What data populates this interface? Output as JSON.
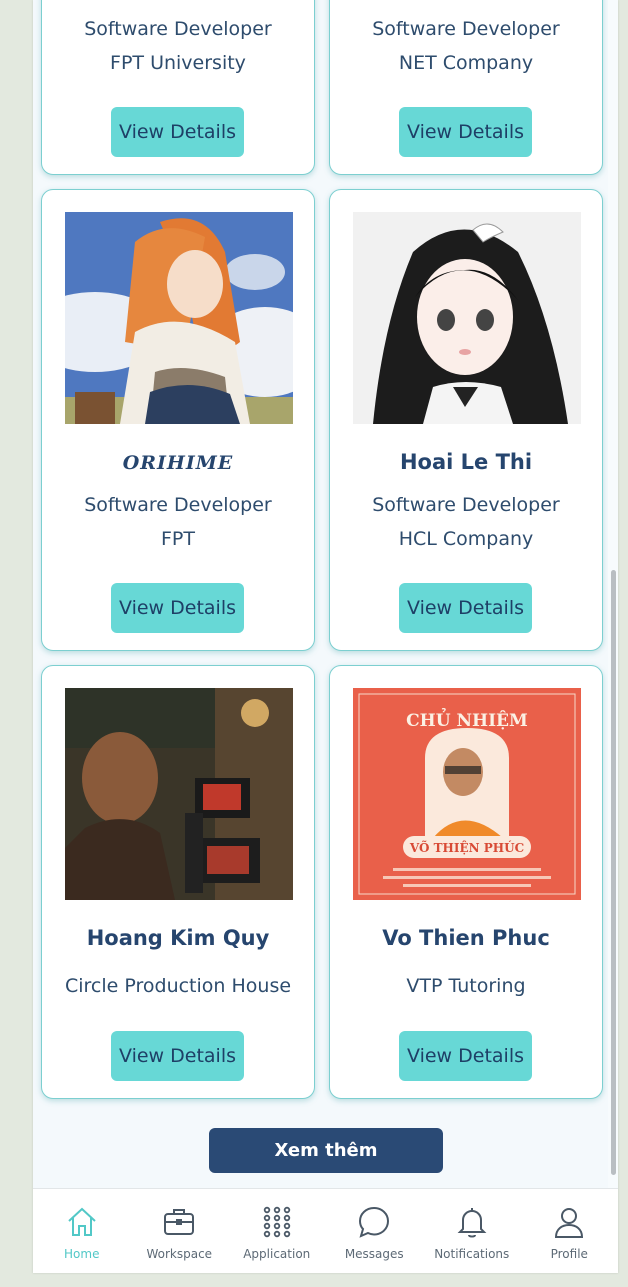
{
  "cards": [
    {
      "name": "",
      "line1": "Software Developer",
      "line2": "FPT University",
      "button": "View Details"
    },
    {
      "name": "",
      "line1": "Software Developer",
      "line2": "NET Company",
      "button": "View Details"
    },
    {
      "name": "ORIHIME",
      "line1": "Software Developer",
      "line2": "FPT",
      "button": "View Details"
    },
    {
      "name": "Hoai Le Thi",
      "line1": "Software Developer",
      "line2": "HCL Company",
      "button": "View Details"
    },
    {
      "name": "Hoang Kim Quy",
      "line1": "Circle Production House",
      "button": "View Details"
    },
    {
      "name": "Vo Thien Phuc",
      "line1": "VTP Tutoring",
      "button": "View Details"
    }
  ],
  "poster": {
    "title": "CHỦ NHIỆM",
    "banner": "VÕ THIỆN PHÚC"
  },
  "more_button": "Xem thêm",
  "nav": {
    "active": "home",
    "items": [
      {
        "id": "home",
        "label": "Home",
        "icon": "home-icon"
      },
      {
        "id": "workspace",
        "label": "Workspace",
        "icon": "briefcase-icon"
      },
      {
        "id": "application",
        "label": "Application",
        "icon": "grid-dots-icon"
      },
      {
        "id": "messages",
        "label": "Messages",
        "icon": "chat-bubble-icon"
      },
      {
        "id": "notifications",
        "label": "Notifications",
        "icon": "bell-icon"
      },
      {
        "id": "profile",
        "label": "Profile",
        "icon": "user-icon"
      }
    ]
  },
  "colors": {
    "accent": "#67d8d6",
    "primary": "#2a4a75",
    "card_border": "#7ccfd0",
    "active_nav": "#52c8c7"
  }
}
